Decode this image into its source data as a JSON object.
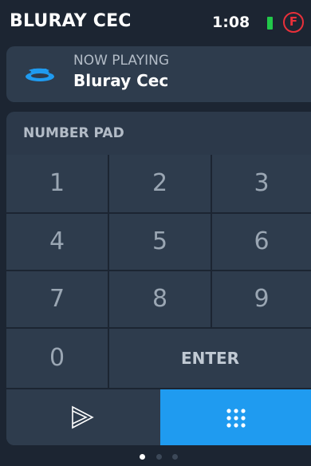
{
  "header": {
    "title": "BLURAY CEC",
    "time": "1:08",
    "battery_color": "#22c84a",
    "badge_letter": "F",
    "badge_color": "#e8303a"
  },
  "now_playing": {
    "label": "NOW PLAYING",
    "title": "Bluray Cec",
    "icon": "bluray-disc-icon"
  },
  "numpad": {
    "label": "NUMBER PAD",
    "keys": [
      "1",
      "2",
      "3",
      "4",
      "5",
      "6",
      "7",
      "8",
      "9",
      "0"
    ],
    "enter_label": "ENTER"
  },
  "bottom_tabs": [
    {
      "name": "play-icon",
      "active": false
    },
    {
      "name": "keypad-grid-icon",
      "active": true
    }
  ],
  "pager": {
    "pages": 3,
    "active_index": 0
  },
  "colors": {
    "background": "#1c2532",
    "panel": "#2e3c4d",
    "accent": "#1f9bf0"
  }
}
